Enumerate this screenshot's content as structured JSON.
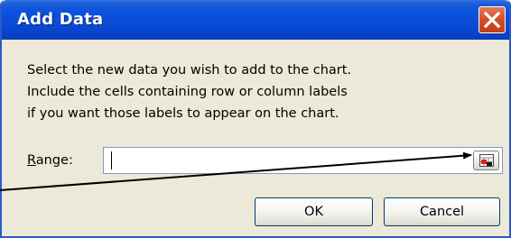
{
  "window": {
    "title": "Add Data"
  },
  "instructions": {
    "line1": "Select the new data you wish to add to the chart.",
    "line2": "Include the cells containing row or column labels",
    "line3": "if you want those labels to appear on the chart."
  },
  "range": {
    "label_accel": "R",
    "label_rest": "ange:",
    "value": ""
  },
  "buttons": {
    "ok": "OK",
    "cancel": "Cancel"
  },
  "icons": {
    "close": "close-icon",
    "collapse": "collapse-dialog-icon"
  },
  "colors": {
    "titlebar": "#0a4bd8",
    "close_button": "#d6502c",
    "dialog_background": "#ece9d8"
  }
}
